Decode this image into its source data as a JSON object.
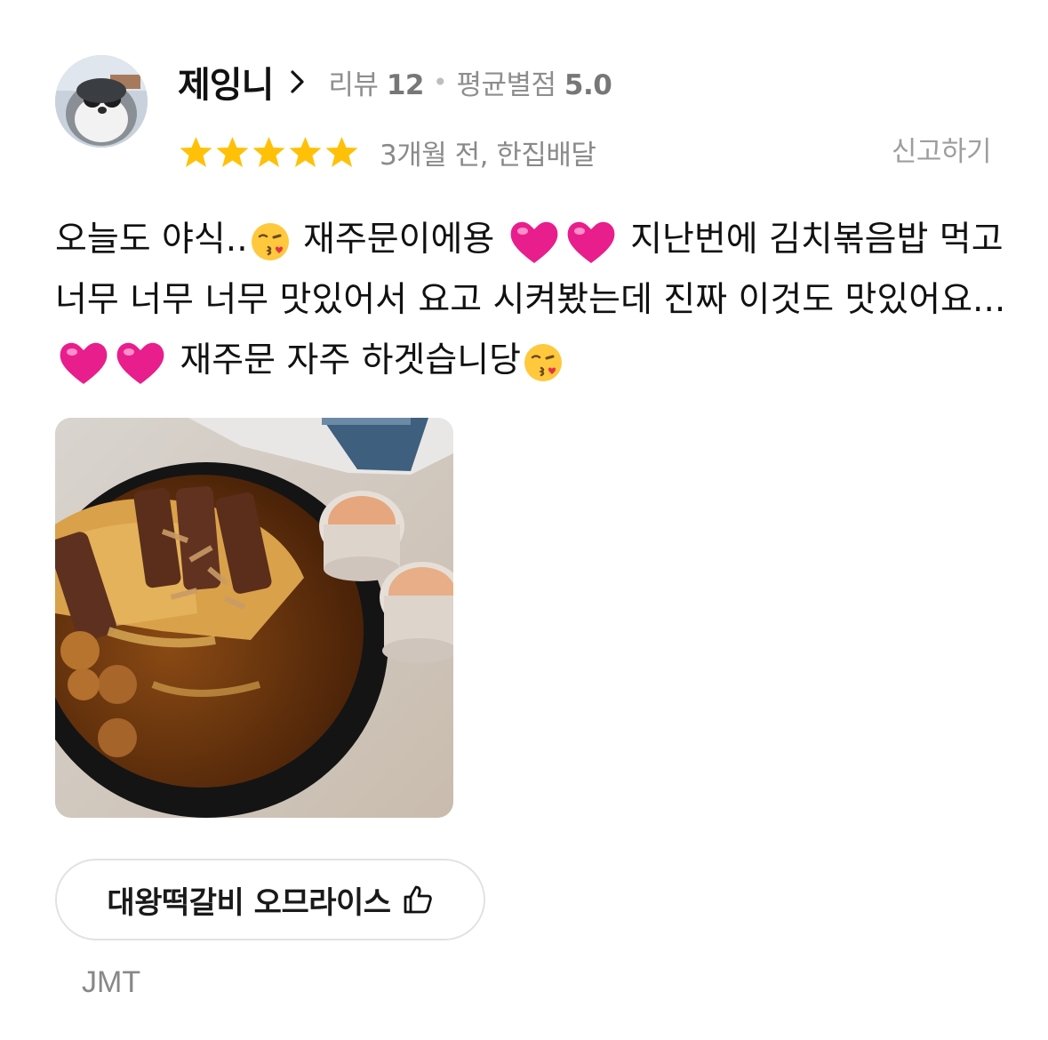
{
  "reviewer": {
    "name": "제잉니",
    "review_count_label": "리뷰",
    "review_count": "12",
    "avg_rating_label": "평균별점",
    "avg_rating": "5.0"
  },
  "review": {
    "rating": 5,
    "time_ago": "3개월 전, 한집배달",
    "report_label": "신고하기",
    "text_parts": [
      "오늘도 야식..",
      "재주문이에용",
      "지난번에 김치볶음밥 먹고 너무 너무 너무 맛있어서 요고 시켜봤는데 진짜 이것도 맛있어요...",
      "재주문 자주 하겟습니당"
    ],
    "photo_alt": "omurice with tteokgalbi and sauce cups"
  },
  "menu": {
    "item_name": "대왕떡갈비 오므라이스",
    "like_icon": "thumbs-up-icon"
  },
  "comment": "JMT",
  "colors": {
    "star": "#FFC107",
    "muted_text": "#8e8e8e",
    "heart": "#E81E8C"
  }
}
